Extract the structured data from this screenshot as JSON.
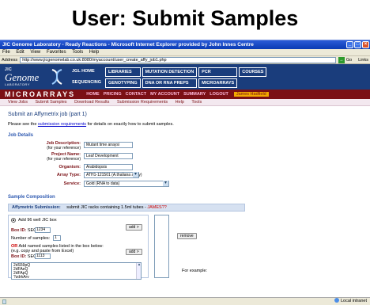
{
  "slide_title": "User: Submit Samples",
  "window": {
    "title": "JIC Genome Laboratory - Ready Reactions - Microsoft Internet Explorer provided by John Innes Centre",
    "menu": [
      "File",
      "Edit",
      "View",
      "Favorites",
      "Tools",
      "Help"
    ],
    "address_label": "Address",
    "url": "http://www.jicgenomelab.co.uk:8080/myaccount/user_create_affy_job1.php",
    "go_label": "Go",
    "links_label": "Links"
  },
  "site": {
    "logo_top": "JIC",
    "logo_main": "Genome",
    "logo_sub": "LABORATORY",
    "nav_row1": [
      "JGL HOME",
      "LIBRARIES",
      "MUTATION DETECTION",
      "PCR",
      "COURSES"
    ],
    "nav_row2": [
      "SEQUENCING",
      "GENOTYPING",
      "DNA OR RNA PREPS",
      "MICROARRAYS"
    ],
    "section_title": "MICROARRAYS",
    "section_nav": [
      "HOME",
      "PRICING",
      "CONTACT",
      "MY ACCOUNT",
      "SUMMARY",
      "LOGOUT"
    ],
    "user_name": "James Hadfield",
    "subnav": [
      "View Jobs",
      "Submit Samples",
      "Download Results",
      "Submission Requirements",
      "Help",
      "Tools"
    ]
  },
  "page": {
    "heading": "Submit an Affymetrix job (part 1)",
    "intro_pre": "Please see the ",
    "intro_link": "submission requirements",
    "intro_post": " for details on exactly how to submit samples.",
    "job_details_title": "Job Details",
    "job_description_label": "Job Description:",
    "job_description_sub": "(for your reference)",
    "job_description_value": "Mutant time anaysi",
    "project_name_label": "Project Name:",
    "project_name_sub": "(for your reference)",
    "project_name_value": "Leaf Development",
    "organism_label": "Organism:",
    "organism_value": "Arabidopsis",
    "array_type_label": "Array Type:",
    "array_type_value": "ATH1-121501 (A.thaliana array)",
    "service_label": "Service:",
    "service_value": "Gold (RNA to data)",
    "sample_composition_title": "Sample Composition",
    "affy_submission_label": "Affymetrix Submission:",
    "affy_submission_text": "submit JIC racks containing 1.5ml tubes - ",
    "affy_submission_warn": "JAMES??",
    "radio_label": "Add 96 well JIC box",
    "box_id_label": "Box ID:",
    "box_id_prefix": "SEQ",
    "box_id_value": "1234",
    "num_samples_label": "Number of samples:",
    "num_samples_value": "1",
    "add_button": "add >",
    "or_label": "OR",
    "or_text": " Add named samples listed in the box below:",
    "or_hint": "(e.g. copy and paste from Excel)",
    "box_id2_value": "1113",
    "add_button2": "add >",
    "remove_button": "remove",
    "textarea_lines": [
      "2dS59pQ",
      "2dFAeQ",
      "2dFApQ",
      "?zdrkArv"
    ],
    "for_example": "For example:"
  },
  "statusbar": {
    "zone": "Local intranet"
  }
}
